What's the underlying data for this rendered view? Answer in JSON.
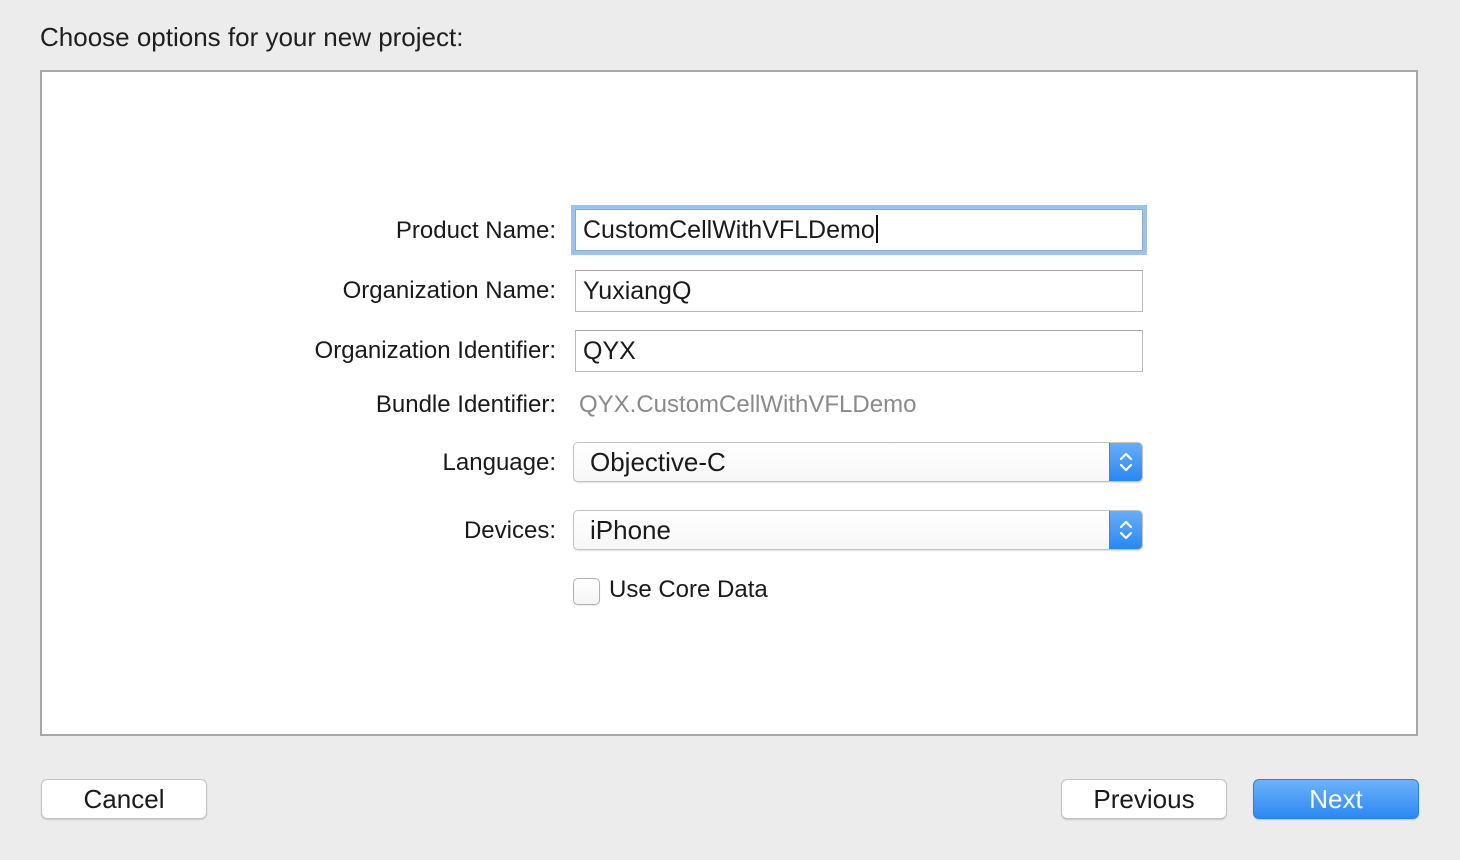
{
  "sheet": {
    "title": "Choose options for your new project:"
  },
  "form": {
    "product_name": {
      "label": "Product Name:",
      "value": "CustomCellWithVFLDemo"
    },
    "organization_name": {
      "label": "Organization Name:",
      "value": "YuxiangQ"
    },
    "organization_identifier": {
      "label": "Organization Identifier:",
      "value": "QYX"
    },
    "bundle_identifier": {
      "label": "Bundle Identifier:",
      "value": "QYX.CustomCellWithVFLDemo"
    },
    "language": {
      "label": "Language:",
      "selected": "Objective-C"
    },
    "devices": {
      "label": "Devices:",
      "selected": "iPhone"
    },
    "use_core_data": {
      "label": "Use Core Data",
      "checked": false
    }
  },
  "buttons": {
    "cancel": "Cancel",
    "previous": "Previous",
    "next": "Next"
  },
  "colors": {
    "accent": "#2d88f3",
    "focus_ring": "#9cc2f0",
    "background": "#ececec",
    "panel": "#ffffff",
    "muted_text": "#8a8a8a"
  },
  "icons": {
    "popup_arrows": "chevron-up-down-icon"
  }
}
